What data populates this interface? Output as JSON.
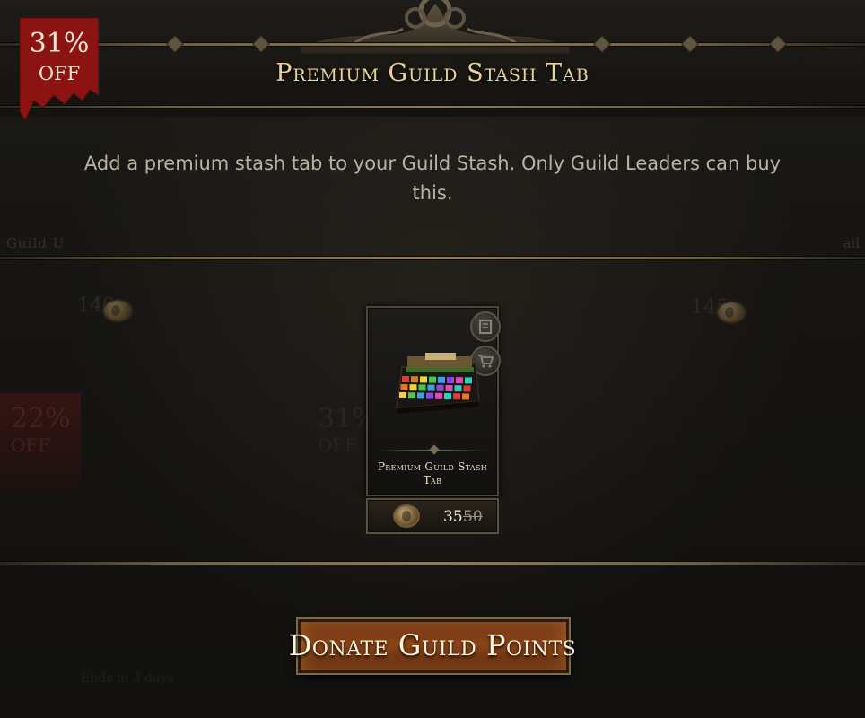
{
  "discount": {
    "percent": "31%",
    "off": "OFF"
  },
  "header": {
    "title": "Premium Guild Stash Tab"
  },
  "description": "Add a premium stash tab to your Guild Stash. Only Guild Leaders can buy this.",
  "item": {
    "name": "Premium Guild Stash Tab",
    "price": "35",
    "original_price": "50",
    "preview_icon": "scroll-icon",
    "cart_icon": "cart-icon",
    "currency_icon": "guild-point-coin-icon"
  },
  "action": {
    "donate_label": "Donate Guild Points"
  },
  "background": {
    "guild_label": "Guild U",
    "right_label": "ail",
    "left_price": "140",
    "right_price": "145",
    "left_discount_percent": "22%",
    "left_discount_off": "OFF",
    "mid_discount_percent": "31%",
    "mid_discount_off": "OFF",
    "ends_text": "Ends in 3 days"
  },
  "colors": {
    "title": "#e9d495",
    "ribbon": "#8b1412",
    "button": "#8a4417",
    "background": "#161512"
  }
}
